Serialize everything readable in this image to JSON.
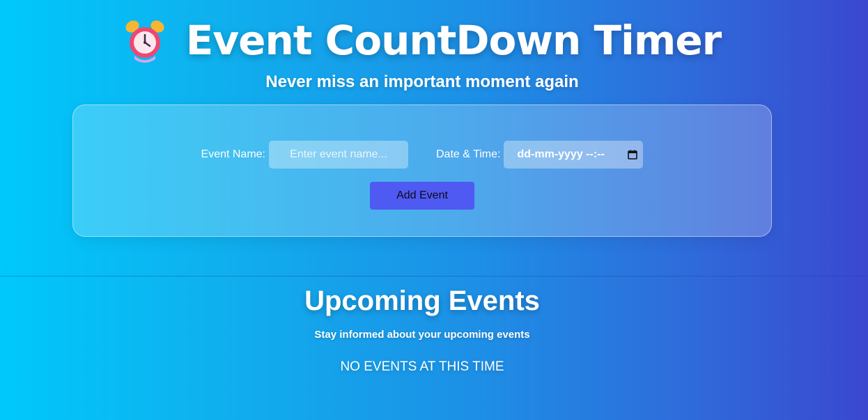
{
  "header": {
    "title": "Event CountDown Timer",
    "subtitle": "Never miss an important moment again",
    "icon": "alarm-clock-icon"
  },
  "form": {
    "event_name_label": "Event Name:",
    "event_name_placeholder": "Enter event name...",
    "event_name_value": "",
    "date_time_label": "Date & Time:",
    "date_time_placeholder": "dd-mm-yyyy --:--",
    "calendar_icon": "calendar-icon",
    "add_button_label": "Add Event"
  },
  "events": {
    "title": "Upcoming Events",
    "subtitle": "Stay informed about your upcoming events",
    "empty_message": "NO EVENTS AT THIS TIME"
  },
  "colors": {
    "gradient_start": "#00c8fb",
    "gradient_end": "#3a48d0",
    "button": "#4f5af2"
  }
}
